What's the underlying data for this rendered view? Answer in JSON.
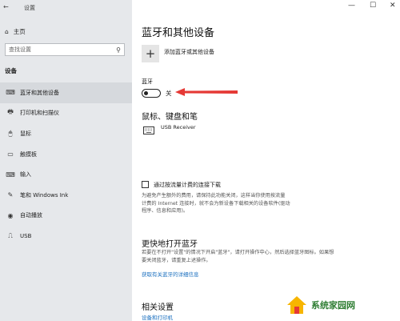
{
  "window": {
    "title": "设置",
    "back_glyph": "←",
    "min": "—",
    "max": "☐",
    "close": "✕"
  },
  "sidebar": {
    "home_label": "主页",
    "search_placeholder": "查找设置",
    "section": "设备",
    "items": [
      {
        "label": "蓝牙和其他设备",
        "icon": "devices-icon",
        "glyph": "⌨",
        "active": true
      },
      {
        "label": "打印机和扫描仪",
        "icon": "printer-icon",
        "glyph": "🖶",
        "active": false
      },
      {
        "label": "鼠标",
        "icon": "mouse-icon",
        "glyph": "🖱",
        "active": false
      },
      {
        "label": "触摸板",
        "icon": "touchpad-icon",
        "glyph": "▭",
        "active": false
      },
      {
        "label": "输入",
        "icon": "keyboard-icon",
        "glyph": "⌨",
        "active": false
      },
      {
        "label": "笔和 Windows Ink",
        "icon": "pen-icon",
        "glyph": "✎",
        "active": false
      },
      {
        "label": "自动播放",
        "icon": "autoplay-icon",
        "glyph": "◉",
        "active": false
      },
      {
        "label": "USB",
        "icon": "usb-icon",
        "glyph": "⎍",
        "active": false
      }
    ]
  },
  "main": {
    "title": "蓝牙和其他设备",
    "add_device": "添加蓝牙或其他设备",
    "bluetooth_label": "蓝牙",
    "bluetooth_state": "关",
    "mouse_section": "鼠标、键盘和笔",
    "device_name": "USB Receiver",
    "metered_label": "通过按流量计费的连接下载",
    "metered_desc": [
      "为避免产生额外的费用，请保持此功能关闭，这样当你使用按流量",
      "计费的 Internet 连接时，就不会为新设备下载相关的设备软件(驱动",
      "程序、信息和应用)。"
    ],
    "faster_title": "更快地打开蓝牙",
    "faster_desc": [
      "若要在不打开\"设置\"的情况下开启\"蓝牙\"，请打开操作中心，然后选择蓝牙图标。如果想",
      "要关闭蓝牙，请重复上述操作。"
    ],
    "more_link": "获取有关蓝牙的详细信息",
    "related_title": "相关设置",
    "related_link": "设备和打印机"
  },
  "watermark": {
    "text": "系统家园网"
  },
  "colors": {
    "accent_link": "#1a6fbf",
    "annotation_arrow": "#e53935",
    "sidebar_bg": "#e6e8eb"
  }
}
